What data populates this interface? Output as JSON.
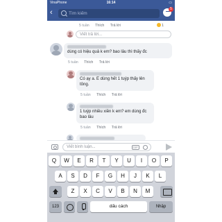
{
  "status_bar": {
    "carrier": "VinaPhone",
    "time": "16:14",
    "battery": "▭"
  },
  "header": {
    "back_glyph": "‹",
    "search_placeholder": "Tìm kiếm",
    "messenger_badge": "5"
  },
  "top_meta": {
    "time": "5 tuần",
    "like": "Thích",
    "reply": "Trả lời",
    "reaction_count": "1"
  },
  "reply_box": {
    "placeholder": "Viết trả lời..."
  },
  "comments": [
    {
      "text": "dùng có hiệu quả k em? bao lâu thì thấy đc",
      "meta": {
        "time": "5 tuần",
        "like": "Thích",
        "reply": "Trả lời"
      }
    },
    {
      "text": "Có ạy a. E dùng hết 1 tuýp thấy lên tông.",
      "meta": {
        "time": "5 tuần",
        "like": "Thích",
        "reply": "Trả lời"
      }
    },
    {
      "text": "1 tuýp nhiều xiền k em? em dùng đc bao lâu",
      "meta": {
        "time": "5 tuần",
        "like": "Thích",
        "reply": "Trả lời"
      }
    }
  ],
  "composer": {
    "placeholder": "Viết bình luận...",
    "gif_label": "GIF"
  },
  "keyboard": {
    "row1": [
      "Q",
      "W",
      "E",
      "R",
      "T",
      "Y",
      "U",
      "I",
      "O",
      "P"
    ],
    "row2": [
      "A",
      "S",
      "D",
      "F",
      "G",
      "H",
      "J",
      "K",
      "L"
    ],
    "row3": [
      "Z",
      "X",
      "C",
      "V",
      "B",
      "N",
      "M"
    ],
    "num_label": "123",
    "space_label": "dấu cách",
    "return_label": "Nhập"
  }
}
